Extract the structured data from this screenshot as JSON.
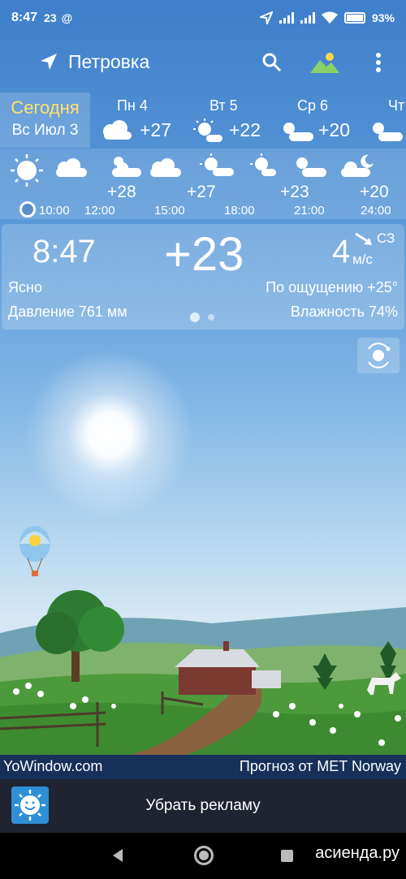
{
  "status_bar": {
    "time": "8:47",
    "notification_temp": "23",
    "battery": "93%"
  },
  "header": {
    "city": "Петровка"
  },
  "daily": {
    "today_label": "Сегодня",
    "today_date": "Вс Июл 3",
    "days": [
      {
        "name": "Пн 4",
        "temp": "+27"
      },
      {
        "name": "Вт 5",
        "temp": "+22"
      },
      {
        "name": "Ср 6",
        "temp": "+20"
      },
      {
        "name": "Чт",
        "temp": ""
      }
    ]
  },
  "hourly": {
    "items": [
      {
        "time": "10:00",
        "temp": ""
      },
      {
        "time": "12:00",
        "temp": "+28"
      },
      {
        "time": "15:00",
        "temp": "+27"
      },
      {
        "time": "18:00",
        "temp": "+23"
      },
      {
        "time": "21:00",
        "temp": "+20"
      },
      {
        "time": "24:00",
        "temp": ""
      }
    ]
  },
  "current": {
    "time": "8:47",
    "temp": "+23",
    "wind_speed": "4",
    "wind_dir": "СЗ",
    "wind_unit": "м/с",
    "condition": "Ясно",
    "feels_like": "По ощущению +25°",
    "pressure": "Давление 761 мм",
    "humidity": "Влажность 74%"
  },
  "credits": {
    "left": "YoWindow.com",
    "right": "Прогноз от MET Norway"
  },
  "ad": {
    "label": "Убрать рекламу"
  },
  "watermark": "асиенда.ру",
  "colors": {
    "accent_today": "#ffe36a",
    "sky_top": "#3f7fcb",
    "footer": "#16305a"
  }
}
